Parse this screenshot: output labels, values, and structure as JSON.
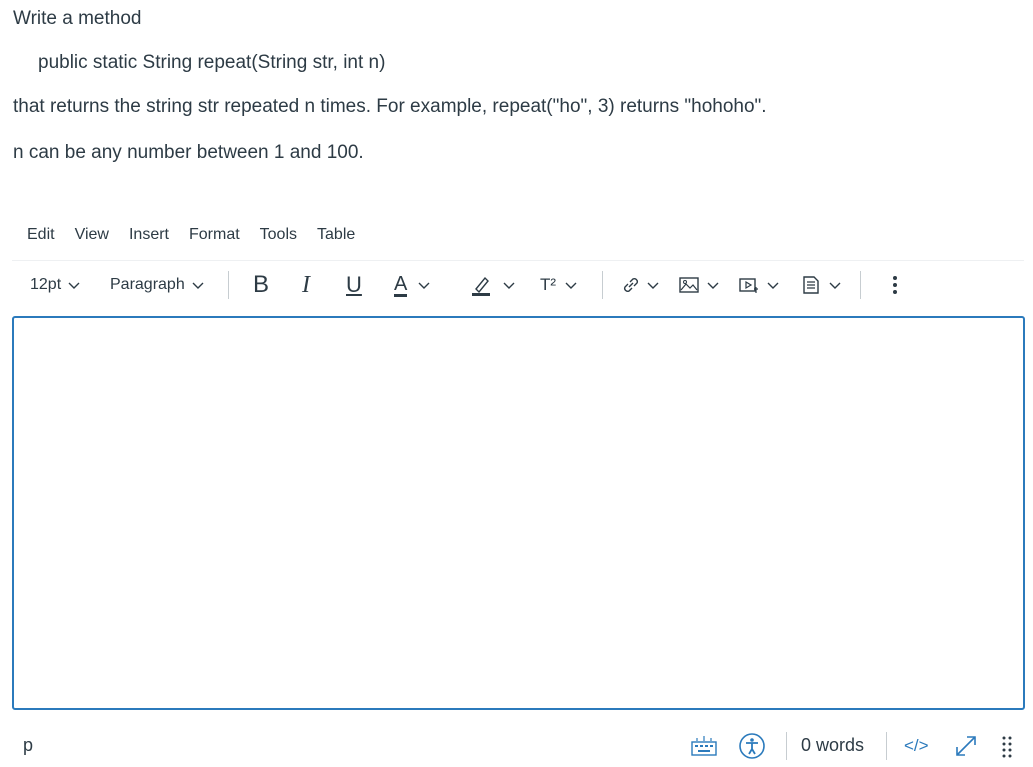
{
  "question": {
    "line1": "Write a method",
    "line2": "public static String repeat(String str, int n)",
    "line3": "that  returns the string str repeated n times.  For example, repeat(\"ho\", 3) returns \"hohoho\".",
    "line4": "n can be any number between 1 and 100."
  },
  "menubar": {
    "items": [
      "Edit",
      "View",
      "Insert",
      "Format",
      "Tools",
      "Table"
    ]
  },
  "toolbar": {
    "font_size": "12pt",
    "block_format": "Paragraph",
    "bold": "B",
    "italic": "I",
    "underline": "U",
    "text_color": "A",
    "superscript": "T²",
    "icons": [
      "chevron-down-icon",
      "highlighter-icon",
      "link-icon",
      "image-icon",
      "media-icon",
      "document-icon",
      "more-vertical-icon"
    ]
  },
  "editor": {
    "content": ""
  },
  "statusbar": {
    "element_path": "p",
    "word_count": "0 words",
    "html_toggle": "</>",
    "icons": [
      "keyboard-icon",
      "accessibility-icon",
      "fullscreen-icon",
      "resize-grip-icon"
    ]
  },
  "colors": {
    "text": "#2d3b45",
    "focus_border": "#2b7abc",
    "separator": "#c7cdd1"
  }
}
